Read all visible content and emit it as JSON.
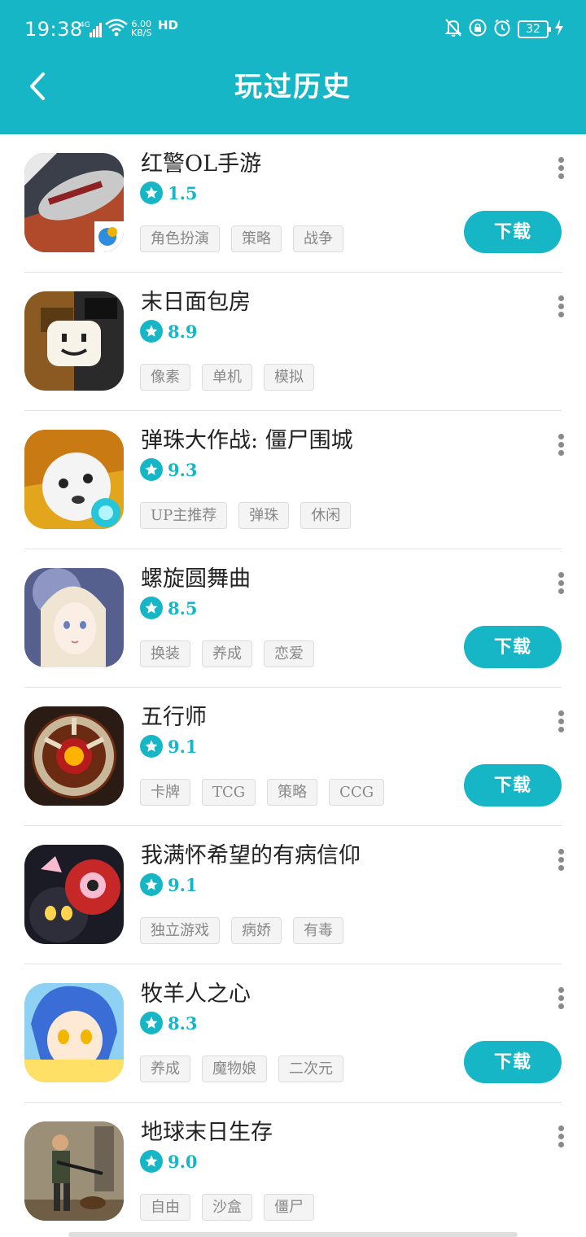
{
  "status_bar": {
    "time": "19:38",
    "network": "4G",
    "speed_value": "6.00",
    "speed_unit": "KB/S",
    "hd": "HD",
    "battery": "32"
  },
  "header": {
    "title": "玩过历史",
    "back_icon": "chevron-left-icon",
    "background_color": "#17b6c6"
  },
  "list": {
    "more_icon": "more-vertical-icon",
    "star_icon": "star-icon",
    "items": [
      {
        "name": "红警OL手游",
        "score": "1.5",
        "tags": [
          "角色扮演",
          "策略",
          "战争"
        ],
        "download_label": "下载",
        "icon": "red-alert-ol-app-icon"
      },
      {
        "name": "末日面包房",
        "score": "8.9",
        "tags": [
          "像素",
          "单机",
          "模拟"
        ],
        "download_label": "",
        "icon": "doomsday-bakery-app-icon"
      },
      {
        "name": "弹珠大作战: 僵尸围城",
        "score": "9.3",
        "tags": [
          "UP主推荐",
          "弹珠",
          "休闲"
        ],
        "download_label": "",
        "icon": "pinball-battle-app-icon"
      },
      {
        "name": "螺旋圆舞曲",
        "score": "8.5",
        "tags": [
          "换装",
          "养成",
          "恋爱"
        ],
        "download_label": "下载",
        "icon": "spiral-waltz-app-icon"
      },
      {
        "name": "五行师",
        "score": "9.1",
        "tags": [
          "卡牌",
          "TCG",
          "策略",
          "CCG"
        ],
        "download_label": "下载",
        "icon": "five-elements-app-icon"
      },
      {
        "name": "我满怀希望的有病信仰",
        "score": "9.1",
        "tags": [
          "独立游戏",
          "病娇",
          "有毒"
        ],
        "download_label": "",
        "icon": "sick-faith-app-icon"
      },
      {
        "name": "牧羊人之心",
        "score": "8.3",
        "tags": [
          "养成",
          "魔物娘",
          "二次元"
        ],
        "download_label": "下载",
        "icon": "shepherds-heart-app-icon"
      },
      {
        "name": "地球末日生存",
        "score": "9.0",
        "tags": [
          "自由",
          "沙盒",
          "僵尸"
        ],
        "download_label": "",
        "icon": "last-day-on-earth-app-icon"
      }
    ]
  }
}
